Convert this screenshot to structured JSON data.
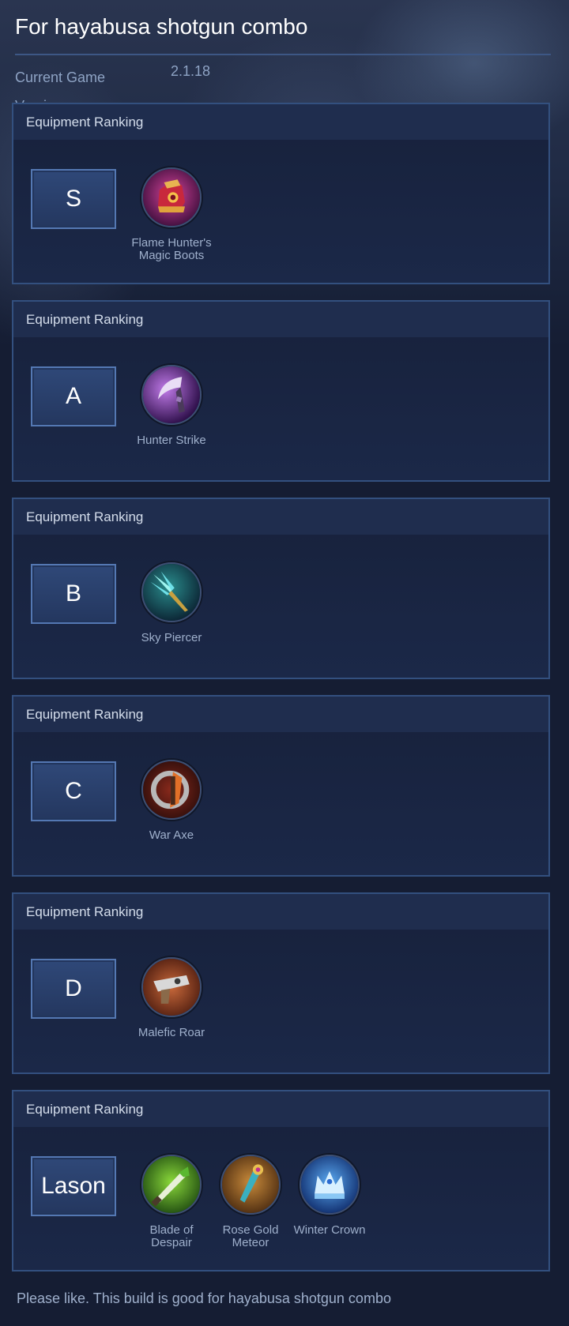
{
  "header": {
    "title": "For hayabusa shotgun combo",
    "version_label": "Current Game Version:",
    "version_value": "2.1.18"
  },
  "tiers": [
    {
      "header": "Equipment Ranking",
      "grade": "S",
      "items": [
        {
          "name": "Flame Hunter's Magic Boots",
          "icon": "flame-hunter-boots-icon"
        }
      ]
    },
    {
      "header": "Equipment Ranking",
      "grade": "A",
      "items": [
        {
          "name": "Hunter Strike",
          "icon": "hunter-strike-icon"
        }
      ]
    },
    {
      "header": "Equipment Ranking",
      "grade": "B",
      "items": [
        {
          "name": "Sky Piercer",
          "icon": "sky-piercer-icon"
        }
      ]
    },
    {
      "header": "Equipment Ranking",
      "grade": "C",
      "items": [
        {
          "name": "War Axe",
          "icon": "war-axe-icon"
        }
      ]
    },
    {
      "header": "Equipment Ranking",
      "grade": "D",
      "items": [
        {
          "name": "Malefic Roar",
          "icon": "malefic-roar-icon"
        }
      ]
    },
    {
      "header": "Equipment Ranking",
      "grade": "Lason",
      "items": [
        {
          "name": "Blade of Despair",
          "icon": "blade-of-despair-icon"
        },
        {
          "name": "Rose Gold Meteor",
          "icon": "rose-gold-meteor-icon"
        },
        {
          "name": "Winter Crown",
          "icon": "winter-crown-icon"
        }
      ]
    }
  ],
  "footer": {
    "text": "Please like. This build is good for hayabusa shotgun combo"
  },
  "colors": {
    "background": "#151d33",
    "panel_border": "#33507f",
    "panel_header": "#1f2d4e",
    "grade_box": "#2f4878",
    "grade_border": "#5478b3",
    "muted_text": "#9fb0cc"
  }
}
